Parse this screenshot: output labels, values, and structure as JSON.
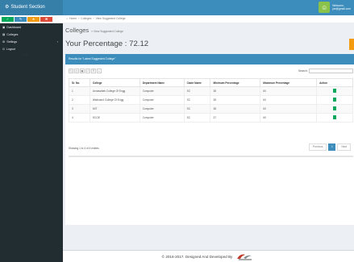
{
  "app": {
    "brand": "Student Section"
  },
  "user": {
    "line1": "Welcome,",
    "line2": "joe@gmail.com"
  },
  "shortcuts": [
    {
      "label": "✓",
      "color": "#00a65a"
    },
    {
      "label": "✎",
      "color": "#3c8dbc"
    },
    {
      "label": "★",
      "color": "#f39c12"
    },
    {
      "label": "✖",
      "color": "#dd4b39"
    }
  ],
  "sidebar": {
    "items": [
      {
        "label": "Dashboard",
        "icon": "▣"
      },
      {
        "label": "Colleges",
        "icon": "▤"
      },
      {
        "label": "Settings",
        "icon": "⚙",
        "arrow": "‹"
      },
      {
        "label": "Logout",
        "icon": "⏻"
      }
    ],
    "dots": "· · · ·"
  },
  "breadcrumb": {
    "home": "Home",
    "sep": "›",
    "section": "Colleges",
    "current": "View Suggested College"
  },
  "page": {
    "title": "Colleges",
    "subtitle": "» View Suggested College",
    "percentage": "Your Percentage : 72.12"
  },
  "box": {
    "header": "Results for \"Latest Suggested College\""
  },
  "tools": [
    "⎘",
    "⎙",
    "▦",
    "⎚",
    "☰",
    "⇣"
  ],
  "search": {
    "label": "Search:"
  },
  "table": {
    "headers": [
      "Sr. No.",
      "College",
      "Department Name",
      "Caste Name",
      "Minimum Percentage",
      "Maximum Percentage",
      "Action"
    ],
    "rows": [
      [
        "1",
        "Annasaheb College Of Engg",
        "Computer",
        "SC",
        "38",
        "60"
      ],
      [
        "2",
        "Walhcand College Of Engg",
        "Computer",
        "SC",
        "38",
        "60"
      ],
      [
        "3",
        "MIT",
        "Computer",
        "SC",
        "38",
        "60"
      ],
      [
        "4",
        "SCOE",
        "Computer",
        "SC",
        "37",
        "60"
      ]
    ]
  },
  "showing": "Showing 1 to 4 of 4 entries",
  "pager": {
    "prev": "Previous",
    "page": "1",
    "next": "Next"
  },
  "footer": {
    "text": "© 2016-2017. Designed And Developed By"
  }
}
